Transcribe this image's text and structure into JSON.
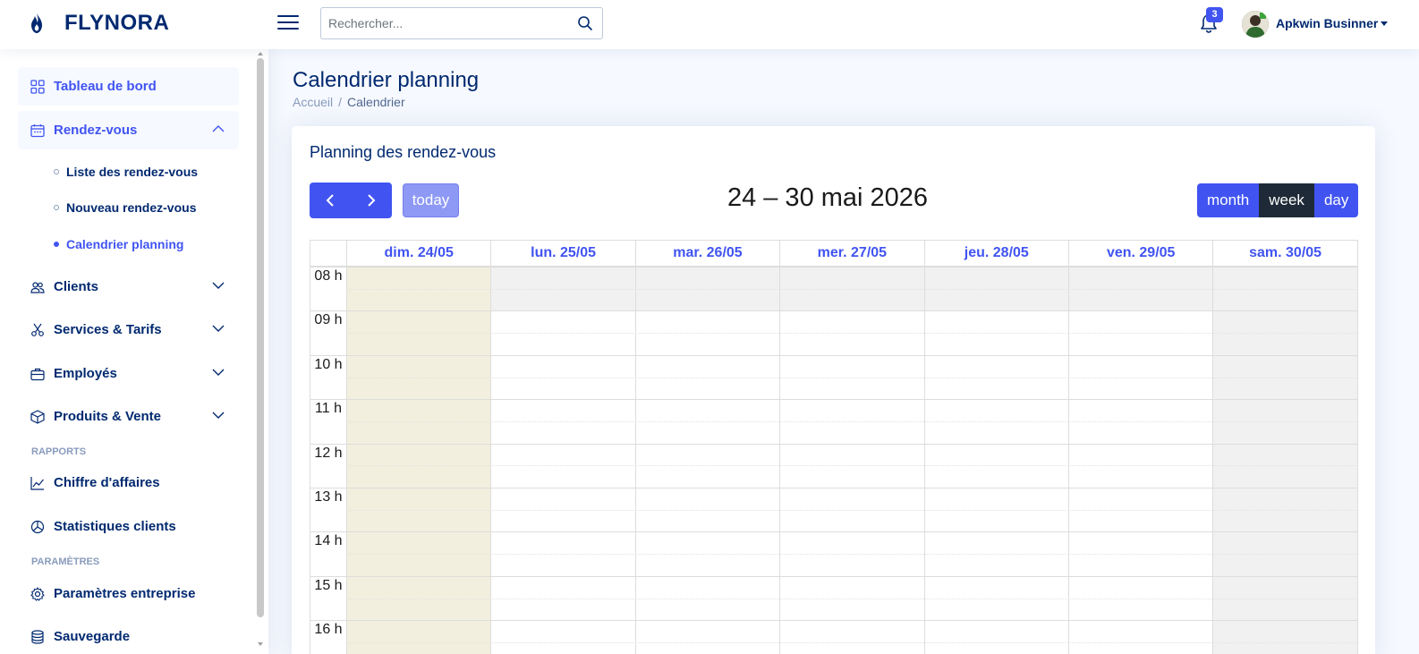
{
  "brand": {
    "name": "FLYNORA"
  },
  "search": {
    "placeholder": "Rechercher..."
  },
  "notifications": {
    "count": "3"
  },
  "user": {
    "name": "Apkwin Businner"
  },
  "sidebar": {
    "items": [
      {
        "label": "Tableau de bord",
        "icon": "grid-icon"
      },
      {
        "label": "Rendez-vous",
        "icon": "calendar-icon"
      },
      {
        "label": "Clients",
        "icon": "people-icon"
      },
      {
        "label": "Services & Tarifs",
        "icon": "scissors-icon"
      },
      {
        "label": "Employés",
        "icon": "briefcase-icon"
      },
      {
        "label": "Produits & Vente",
        "icon": "box-icon"
      },
      {
        "label": "Chiffre d'affaires",
        "icon": "chart-line-icon"
      },
      {
        "label": "Statistiques clients",
        "icon": "pie-chart-icon"
      },
      {
        "label": "Paramètres entreprise",
        "icon": "gear-icon"
      },
      {
        "label": "Sauvegarde",
        "icon": "database-icon"
      }
    ],
    "subitems": [
      {
        "label": "Liste des rendez-vous"
      },
      {
        "label": "Nouveau rendez-vous"
      },
      {
        "label": "Calendrier planning"
      }
    ],
    "headings": {
      "reports": "RAPPORTS",
      "settings": "PARAMÈTRES"
    }
  },
  "page": {
    "title": "Calendrier planning",
    "breadcrumb": {
      "home": "Accueil",
      "separator": "/",
      "current": "Calendrier"
    }
  },
  "card": {
    "title": "Planning des rendez-vous"
  },
  "calendar": {
    "title": "24 – 30 mai 2026",
    "today_label": "today",
    "views": {
      "month": "month",
      "week": "week",
      "day": "day"
    },
    "active_view": "week",
    "days": [
      {
        "label": "dim. 24/05"
      },
      {
        "label": "lun. 25/05"
      },
      {
        "label": "mar. 26/05"
      },
      {
        "label": "mer. 27/05"
      },
      {
        "label": "jeu. 28/05"
      },
      {
        "label": "ven. 29/05"
      },
      {
        "label": "sam. 30/05"
      }
    ],
    "hours": [
      "08 h",
      "09 h",
      "10 h",
      "11 h",
      "12 h",
      "13 h",
      "14 h",
      "15 h",
      "16 h"
    ]
  },
  "colors": {
    "accent": "#4154f1",
    "navy": "#012970",
    "today_bg": "#f2efde",
    "closed_bg": "#f1f1f1",
    "active_view_bg": "#1e2a37"
  }
}
